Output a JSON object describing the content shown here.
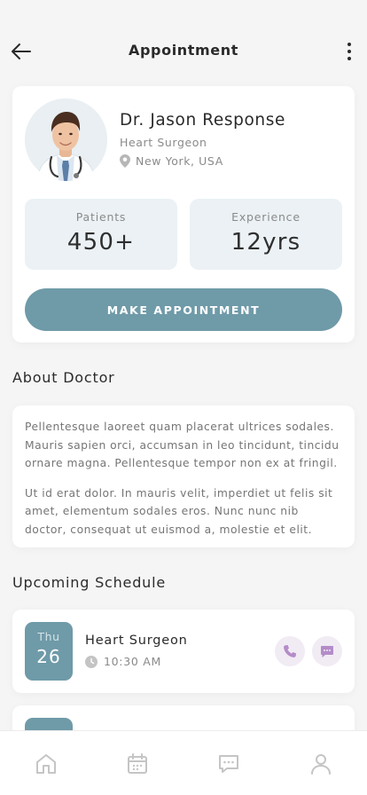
{
  "header": {
    "title": "Appointment"
  },
  "doctor": {
    "name": "Dr. Jason Response",
    "specialty": "Heart Surgeon",
    "location": "New York, USA"
  },
  "stats": {
    "patients_label": "Patients",
    "patients_value": "450+",
    "experience_label": "Experience",
    "experience_value": "12yrs"
  },
  "appointment_button": "MAKE APPOINTMENT",
  "about": {
    "title": "About Doctor",
    "paragraphs": [
      "Pellentesque laoreet quam placerat ultrices sodales. Mauris sapien orci, accumsan in leo tincidunt, tincidu ornare magna. Pellentesque tempor non ex at fringil.",
      "Ut id erat dolor. In mauris velit, imperdiet ut felis sit amet, elementum sodales eros. Nunc nunc nib doctor, consequat ut euismod a, molestie et elit."
    ]
  },
  "schedule": {
    "title": "Upcoming Schedule",
    "items": [
      {
        "day": "Thu",
        "date": "26",
        "title": "Heart Surgeon",
        "time": "10:30 AM"
      }
    ]
  },
  "nav": {
    "items": [
      {
        "icon": "home-icon"
      },
      {
        "icon": "calendar-icon"
      },
      {
        "icon": "chat-icon"
      },
      {
        "icon": "profile-icon"
      }
    ]
  },
  "colors": {
    "accent": "#6f9aa8",
    "stat_bg": "#ebf1f4",
    "action_bg": "#f1ebf4",
    "action_icon": "#b48cc8"
  }
}
